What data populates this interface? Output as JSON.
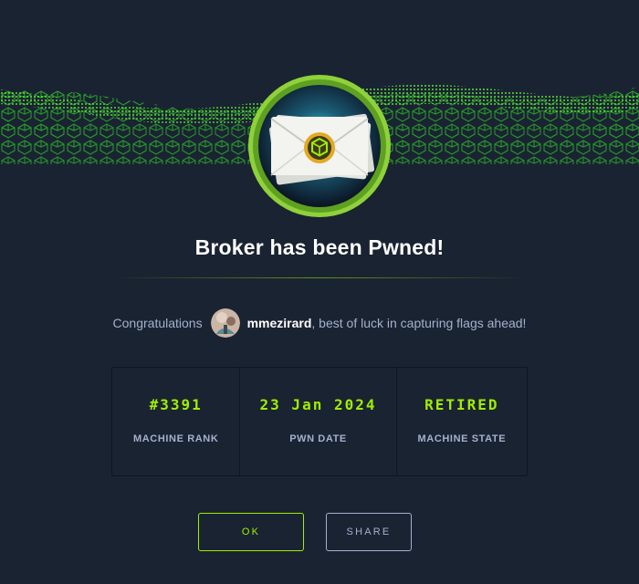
{
  "modal": {
    "title": "Broker has been Pwned!",
    "congrats_prefix": "Congratulations",
    "username": "mmezirard",
    "congrats_suffix": ", best of luck in capturing flags ahead!"
  },
  "stats": [
    {
      "value": "#3391",
      "label": "MACHINE RANK"
    },
    {
      "value": "23 Jan 2024",
      "label": "PWN DATE"
    },
    {
      "value": "RETIRED",
      "label": "MACHINE STATE"
    }
  ],
  "buttons": {
    "ok_label": "OK",
    "share_label": "SHARE"
  },
  "colors": {
    "background": "#1a2332",
    "accent": "#9fef00",
    "text_muted": "#a4b1cd",
    "text_primary": "#ffffff",
    "border": "#0f1622"
  },
  "icons": {
    "machine_avatar": "envelope-with-seal-icon",
    "user_avatar": "user-avatar",
    "banner": "green-cube-wave-banner"
  }
}
